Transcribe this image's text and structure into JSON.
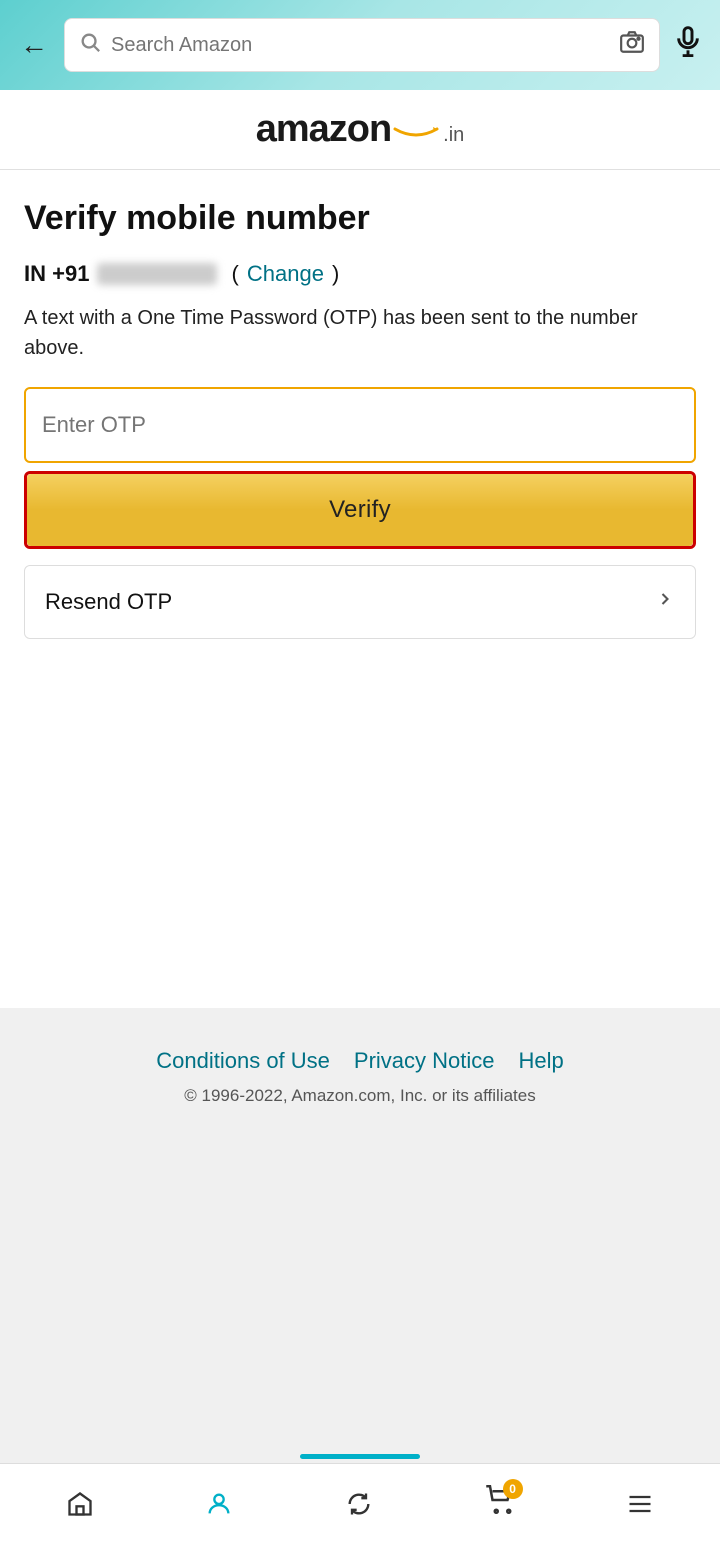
{
  "browser": {
    "back_label": "←",
    "search_placeholder": "Search Amazon",
    "search_icon": "🔍",
    "camera_icon": "⊡",
    "mic_icon": "🎤"
  },
  "header": {
    "logo_text": "amazon",
    "logo_tld": ".in",
    "logo_arrow": "↗"
  },
  "page": {
    "title": "Verify mobile number",
    "phone_prefix": "IN +91",
    "phone_number_blurred": true,
    "change_label": "Change",
    "otp_description": "A text with a One Time Password (OTP) has been sent to the number above.",
    "otp_placeholder": "Enter OTP",
    "verify_button": "Verify",
    "resend_otp": "Resend OTP"
  },
  "footer": {
    "conditions": "Conditions of Use",
    "privacy": "Privacy Notice",
    "help": "Help",
    "copyright": "© 1996-2022, Amazon.com, Inc. or its affiliates"
  },
  "bottom_nav": {
    "home_icon": "home",
    "profile_icon": "person",
    "refresh_icon": "refresh",
    "cart_icon": "cart",
    "cart_count": "0",
    "menu_icon": "menu"
  }
}
